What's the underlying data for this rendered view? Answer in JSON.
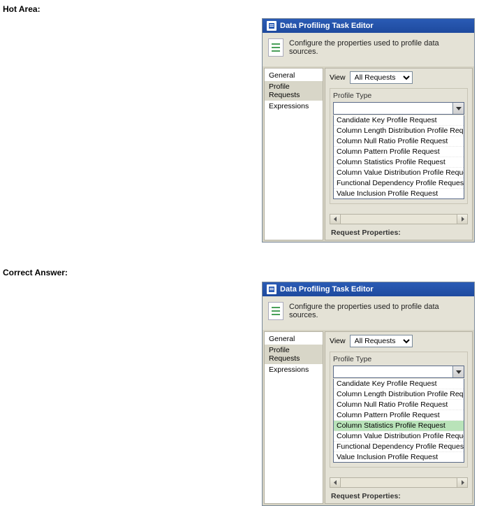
{
  "labels": {
    "hot_area": "Hot Area:",
    "correct_answer": "Correct Answer:"
  },
  "editor": {
    "title": "Data Profiling Task Editor",
    "description": "Configure the properties used to profile data sources.",
    "nav": {
      "items": [
        "General",
        "Profile Requests",
        "Expressions"
      ],
      "selected_index": 1
    },
    "view": {
      "label": "View",
      "value": "All Requests"
    },
    "profile_type": {
      "label": "Profile Type",
      "options": [
        "Candidate Key Profile Request",
        "Column Length Distribution Profile Request",
        "Column Null Ratio Profile Request",
        "Column Pattern Profile Request",
        "Column Statistics Profile Request",
        "Column Value Distribution Profile Request",
        "Functional Dependency Profile Request",
        "Value Inclusion Profile Request"
      ]
    },
    "request_properties_label": "Request Properties:"
  },
  "highlight": {
    "top_index": -1,
    "bottom_index": 4
  }
}
